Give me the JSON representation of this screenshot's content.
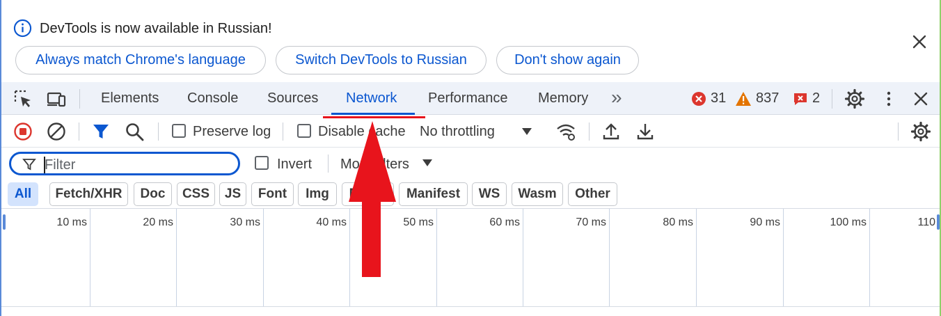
{
  "infobar": {
    "message": "DevTools is now available in Russian!",
    "buttons": [
      "Always match Chrome's language",
      "Switch DevTools to Russian",
      "Don't show again"
    ]
  },
  "tabs": {
    "items": [
      "Elements",
      "Console",
      "Sources",
      "Network",
      "Performance",
      "Memory"
    ],
    "active": "Network",
    "more_glyph": "»"
  },
  "status": {
    "errors": "31",
    "warnings": "837",
    "issues": "2"
  },
  "toolbar": {
    "preserve_log": "Preserve log",
    "disable_cache": "Disable cache",
    "throttling": "No throttling"
  },
  "filter": {
    "placeholder": "Filter",
    "invert": "Invert",
    "more_filters": "More filters"
  },
  "type_filters": [
    "All",
    "Fetch/XHR",
    "Doc",
    "CSS",
    "JS",
    "Font",
    "Img",
    "Media",
    "Manifest",
    "WS",
    "Wasm",
    "Other"
  ],
  "timeline_ticks": [
    "10 ms",
    "20 ms",
    "30 ms",
    "40 ms",
    "50 ms",
    "60 ms",
    "70 ms",
    "80 ms",
    "90 ms",
    "100 ms",
    "110"
  ],
  "colors": {
    "accent": "#0b57d0",
    "annotation": "#e8141c",
    "error": "#dc362e",
    "warning": "#e37400"
  }
}
